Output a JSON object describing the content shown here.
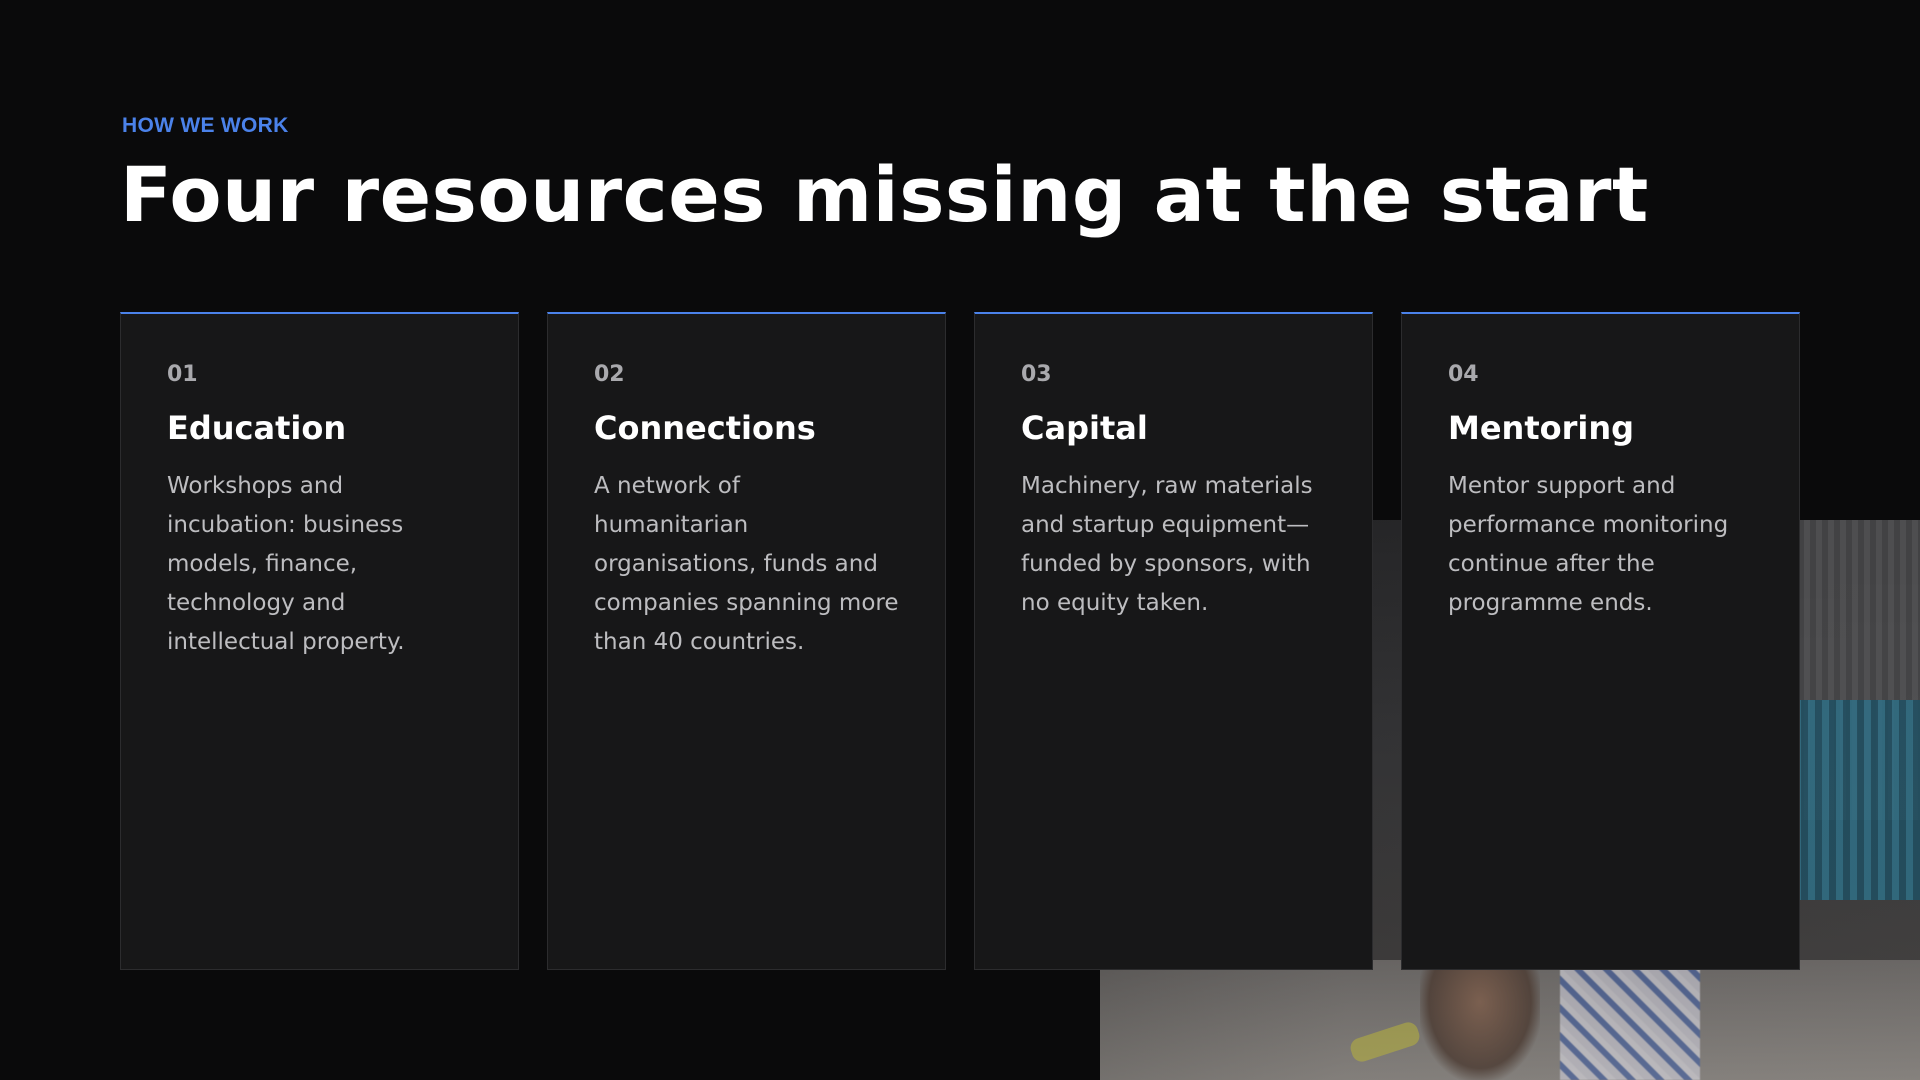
{
  "header": {
    "eyebrow": "HOW WE WORK",
    "title": "Four resources missing at the start"
  },
  "cards": [
    {
      "number": "01",
      "title": "Education",
      "description": "Workshops and incubation: business models, finance, technology and intellectual property."
    },
    {
      "number": "02",
      "title": "Connections",
      "description": "A network of humanitarian organisations, funds and companies spanning more than 40 countries."
    },
    {
      "number": "03",
      "title": "Capital",
      "description": "Machinery, raw materials and startup equipment—funded by sponsors, with no equity taken."
    },
    {
      "number": "04",
      "title": "Mentoring",
      "description": "Mentor support and performance monitoring continue after the programme ends."
    }
  ],
  "colors": {
    "background": "#0a0a0b",
    "accent": "#4b82ea",
    "card": "#171718"
  }
}
